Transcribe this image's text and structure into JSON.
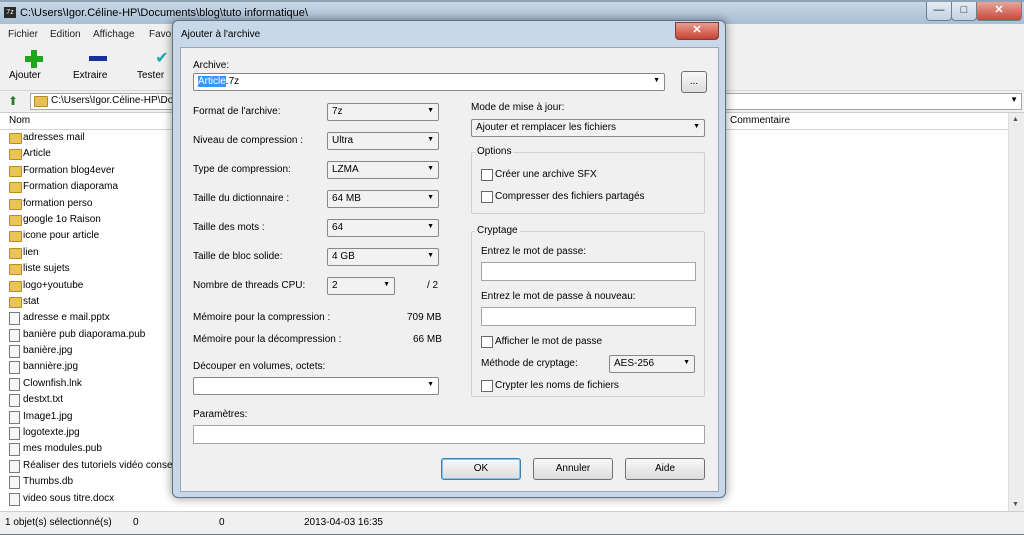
{
  "window": {
    "title": "C:\\Users\\Igor.Céline-HP\\Documents\\blog\\tuto informatique\\",
    "app_icon_text": "7z",
    "controls": {
      "minimize": "—",
      "maximize": "□",
      "close": "✕"
    }
  },
  "menu": [
    "Fichier",
    "Edition",
    "Affichage",
    "Favo"
  ],
  "toolbar": [
    {
      "label": "Ajouter",
      "icon": "plus-icon"
    },
    {
      "label": "Extraire",
      "icon": "minus-icon"
    },
    {
      "label": "Tester",
      "icon": "check-icon"
    }
  ],
  "address": {
    "path": "C:\\Users\\Igor.Céline-HP\\Do"
  },
  "columns": {
    "name": "Nom",
    "comment": "Commentaire"
  },
  "files": [
    {
      "name": "adresses mail",
      "type": "folder"
    },
    {
      "name": "Article",
      "type": "folder"
    },
    {
      "name": "Formation blog4ever",
      "type": "folder"
    },
    {
      "name": "Formation diaporama",
      "type": "folder"
    },
    {
      "name": "formation perso",
      "type": "folder"
    },
    {
      "name": "google 1o Raison",
      "type": "folder"
    },
    {
      "name": "icone pour article",
      "type": "folder"
    },
    {
      "name": "lien",
      "type": "folder"
    },
    {
      "name": "liste sujets",
      "type": "folder"
    },
    {
      "name": "logo+youtube",
      "type": "folder"
    },
    {
      "name": "stat",
      "type": "folder"
    },
    {
      "name": "adresse e mail.pptx",
      "type": "file"
    },
    {
      "name": "banière pub diaporama.pub",
      "type": "file"
    },
    {
      "name": "banière.jpg",
      "type": "file"
    },
    {
      "name": "bannière.jpg",
      "type": "file"
    },
    {
      "name": "Clownfish.lnk",
      "type": "file"
    },
    {
      "name": "destxt.txt",
      "type": "file"
    },
    {
      "name": "Image1.jpg",
      "type": "file"
    },
    {
      "name": "logotexte.jpg",
      "type": "file"
    },
    {
      "name": "mes modules.pub",
      "type": "file"
    },
    {
      "name": "Réaliser des tutoriels vidéo consei",
      "type": "file"
    },
    {
      "name": "Thumbs.db",
      "type": "file"
    },
    {
      "name": "video sous titre.docx",
      "type": "file"
    }
  ],
  "status": {
    "selected": "1 objet(s) sélectionné(s)",
    "size1": "0",
    "size2": "0",
    "date": "2013-04-03 16:35"
  },
  "dialog": {
    "title": "Ajouter à l'archive",
    "archive_label": "Archive:",
    "archive_value_selected": "Article",
    "archive_value_rest": ".7z",
    "browse_label": "...",
    "format_label": "Format de l'archive:",
    "format_value": "7z",
    "level_label": "Niveau de compression :",
    "level_value": "Ultra",
    "type_label": "Type de compression:",
    "type_value": "LZMA",
    "dict_label": "Taille du dictionnaire :",
    "dict_value": "64 MB",
    "word_label": "Taille des mots :",
    "word_value": "64",
    "solid_label": "Taille de bloc solide:",
    "solid_value": "4 GB",
    "threads_label": "Nombre de threads CPU:",
    "threads_value": "2",
    "threads_max": "/ 2",
    "mem_comp_label": "Mémoire pour la compression :",
    "mem_comp_value": "709 MB",
    "mem_decomp_label": "Mémoire pour la décompression :",
    "mem_decomp_value": "66 MB",
    "split_label": "Découper en volumes, octets:",
    "split_value": "",
    "params_label": "Paramètres:",
    "params_value": "",
    "update_label": "Mode de mise à jour:",
    "update_value": "Ajouter et remplacer les fichiers",
    "options_label": "Options",
    "sfx_label": "Créer une archive SFX",
    "shared_label": "Compresser des fichiers partagés",
    "crypt_label": "Cryptage",
    "pwd_label": "Entrez le mot de passe:",
    "pwd2_label": "Entrez le mot de passe à nouveau:",
    "show_pwd_label": "Afficher le mot de passe",
    "method_label": "Méthode de cryptage:",
    "method_value": "AES-256",
    "crypt_names_label": "Crypter les noms de fichiers",
    "ok_label": "OK",
    "cancel_label": "Annuler",
    "help_label": "Aide"
  }
}
